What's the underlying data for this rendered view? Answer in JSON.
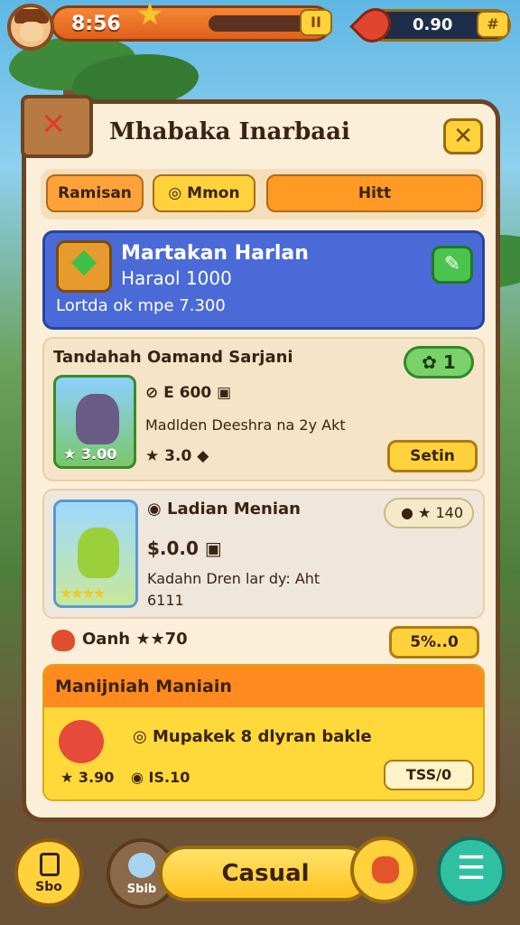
{
  "hud": {
    "timer": "8:56",
    "xp_button": "II",
    "coins": "0.90",
    "coins_button": "#"
  },
  "panel": {
    "title": "Mhabaka Inarbaai",
    "close_icon": "x-icon",
    "tabs": [
      "Ramisan",
      "Mmon",
      "Hitt"
    ]
  },
  "hero": {
    "title": "Martakan Harlan",
    "subtitle": "Haraol 1000",
    "detail": "Lortda ok mpe 7.300",
    "edit_icon": "pencil-icon"
  },
  "item1": {
    "title": "Tandahah Oamand Sarjani",
    "badge": "1",
    "price_chip": "E 600",
    "desc": "Madlden Deeshra na 2y Akt",
    "pet_price": "3.00",
    "rating": "3.0",
    "button": "Setin"
  },
  "item2": {
    "title": "Ladian Menian",
    "pill": "140",
    "price": "$.0.0",
    "desc_1": "Kadahn Dren lar dy: Aht",
    "desc_2": "6111"
  },
  "summary": {
    "label": "Oanh",
    "stars_value": "70",
    "button": "5%..0"
  },
  "special": {
    "title": "Manijniah Maniain",
    "desc": "Mupakek 8 dlyran bakle",
    "rating": "3.90",
    "value": "IS.10",
    "buy": "TSS/0"
  },
  "bottom": {
    "left_label": "Sbo",
    "pet_label": "Sbib",
    "main_button": "Casual",
    "menu_icon": "menu-icon"
  },
  "colors": {
    "panel_bg": "#fbefd9",
    "hero_blue": "#4a6ad8",
    "accent_orange": "#ff8a1e",
    "accent_yellow": "#ffd23c",
    "badge_green": "#7bd16a"
  }
}
